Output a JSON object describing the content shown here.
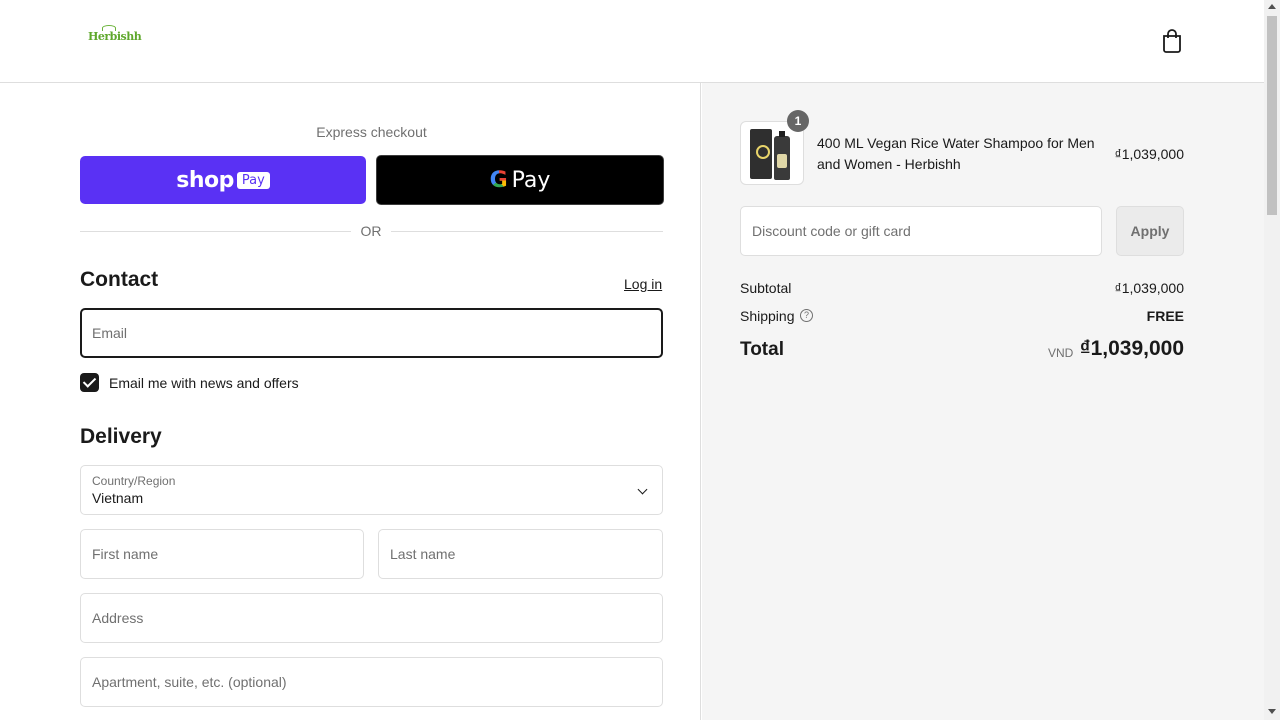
{
  "header": {
    "logo_text": "Herbishh",
    "cart_icon": "shopping-bag-icon"
  },
  "express": {
    "title": "Express checkout",
    "shop_pay_label": "shop",
    "shop_pay_badge": "Pay",
    "gpay_label": "Pay",
    "gpay_g": "G",
    "or_text": "OR"
  },
  "contact": {
    "title": "Contact",
    "login_label": "Log in",
    "email_placeholder": "Email",
    "newsletter_label": "Email me with news and offers",
    "newsletter_checked": true
  },
  "delivery": {
    "title": "Delivery",
    "country_label": "Country/Region",
    "country_value": "Vietnam",
    "first_name_placeholder": "First name",
    "last_name_placeholder": "Last name",
    "address_placeholder": "Address",
    "apartment_placeholder": "Apartment, suite, etc. (optional)"
  },
  "summary": {
    "product": {
      "quantity": "1",
      "name": "400 ML Vegan Rice Water Shampoo for Men and Women - Herbishh",
      "price": "₫1,039,000"
    },
    "discount_placeholder": "Discount code or gift card",
    "apply_label": "Apply",
    "subtotal_label": "Subtotal",
    "subtotal_value": "₫1,039,000",
    "shipping_label": "Shipping",
    "shipping_help": "?",
    "shipping_value": "FREE",
    "total_label": "Total",
    "currency": "VND",
    "total_value": "₫1,039,000"
  },
  "colors": {
    "shop_pay": "#5a31f4",
    "gpay": "#000000",
    "summary_bg": "#f5f5f5"
  }
}
